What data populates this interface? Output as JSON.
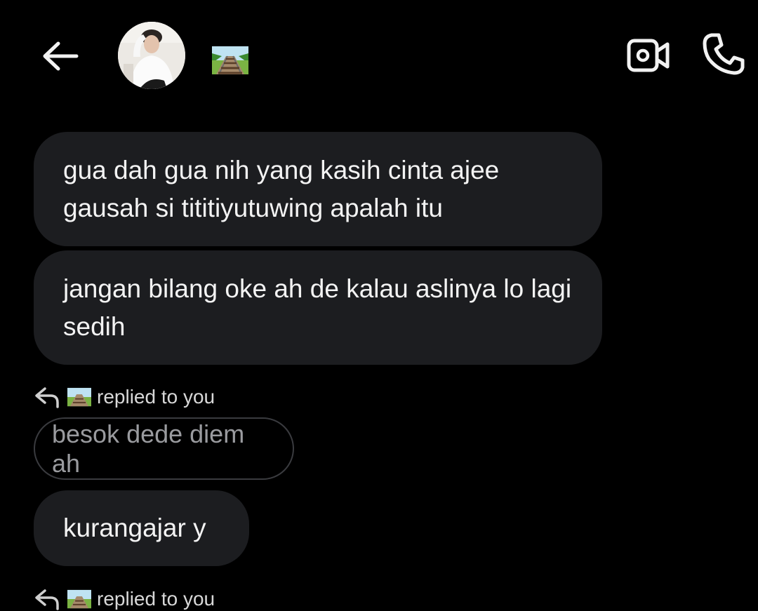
{
  "header": {
    "back_icon": "arrow-left-icon",
    "avatar_icon": "profile-avatar",
    "name_icon": "railway-track-emoji",
    "video_icon": "video-camera-icon",
    "call_icon": "phone-icon"
  },
  "messages": [
    {
      "text": "gua dah gua nih yang kasih cinta ajee gausah si tititiyutuwing apalah itu"
    },
    {
      "text": "jangan bilang oke ah de kalau aslinya lo lagi sedih"
    },
    {
      "text": "kurangajar y"
    }
  ],
  "replies": [
    {
      "label": "replied to you",
      "quoted": "besok dede diem ah"
    },
    {
      "label": "replied to you"
    }
  ],
  "colors": {
    "background": "#000000",
    "bubble": "#1c1d20",
    "text": "#f3f3f3",
    "quoted_text": "#9a9b9f",
    "quoted_border": "#3a3b3f"
  }
}
